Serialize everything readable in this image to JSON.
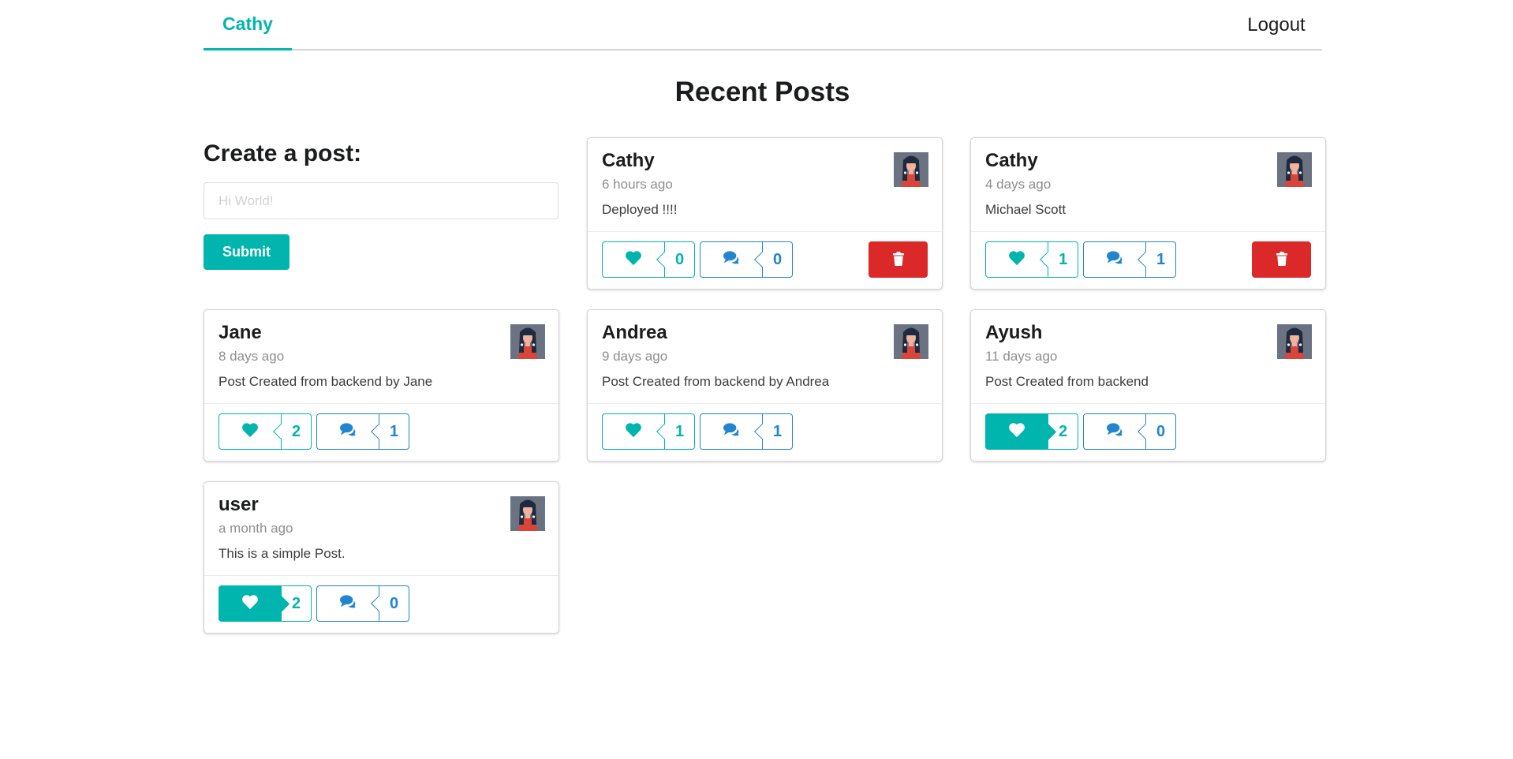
{
  "menu": {
    "active_item": "Cathy",
    "logout_label": "Logout"
  },
  "page": {
    "title": "Recent Posts"
  },
  "form": {
    "heading": "Create a post:",
    "placeholder": "Hi World!",
    "submit_label": "Submit"
  },
  "colors": {
    "accent": "#00b5ad",
    "comment": "#2185d0",
    "danger": "#db2828"
  },
  "posts": [
    {
      "author": "Cathy",
      "time": "6 hours ago",
      "text": "Deployed !!!!",
      "likes": "0",
      "comments": "0",
      "liked": false,
      "deletable": true
    },
    {
      "author": "Cathy",
      "time": "4 days ago",
      "text": "Michael Scott",
      "likes": "1",
      "comments": "1",
      "liked": false,
      "deletable": true
    },
    {
      "author": "Jane",
      "time": "8 days ago",
      "text": "Post Created from backend by Jane",
      "likes": "2",
      "comments": "1",
      "liked": false,
      "deletable": false
    },
    {
      "author": "Andrea",
      "time": "9 days ago",
      "text": "Post Created from backend by Andrea",
      "likes": "1",
      "comments": "1",
      "liked": false,
      "deletable": false
    },
    {
      "author": "Ayush",
      "time": "11 days ago",
      "text": "Post Created from backend",
      "likes": "2",
      "comments": "0",
      "liked": true,
      "deletable": false
    },
    {
      "author": "user",
      "time": "a month ago",
      "text": "This is a simple Post.",
      "likes": "2",
      "comments": "0",
      "liked": true,
      "deletable": false
    }
  ]
}
